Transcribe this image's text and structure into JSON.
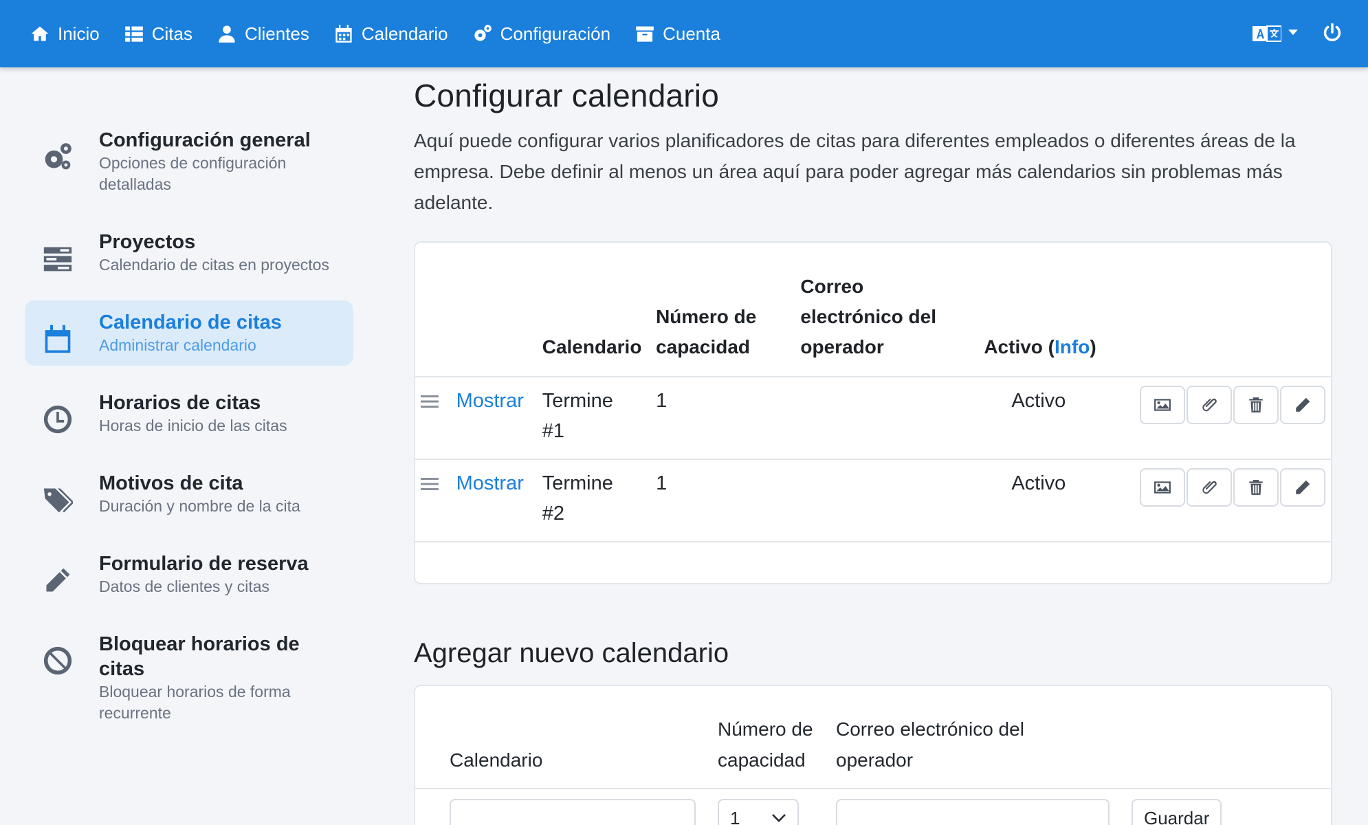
{
  "nav": {
    "items": [
      {
        "label": "Inicio",
        "icon": "home-icon"
      },
      {
        "label": "Citas",
        "icon": "list-icon"
      },
      {
        "label": "Clientes",
        "icon": "user-icon"
      },
      {
        "label": "Calendario",
        "icon": "calendar-icon"
      },
      {
        "label": "Configuración",
        "icon": "gears-icon"
      },
      {
        "label": "Cuenta",
        "icon": "archive-icon"
      }
    ],
    "accent": "#1b7fdc"
  },
  "sidebar": {
    "items": [
      {
        "title": "Configuración general",
        "subtitle": "Opciones de configuración detalladas",
        "icon": "gears-icon"
      },
      {
        "title": "Proyectos",
        "subtitle": "Calendario de citas en proyectos",
        "icon": "server-icon"
      },
      {
        "title": "Calendario de citas",
        "subtitle": "Administrar calendario",
        "icon": "calendar-icon",
        "active": true
      },
      {
        "title": "Horarios de citas",
        "subtitle": "Horas de inicio de las citas",
        "icon": "clock-icon"
      },
      {
        "title": "Motivos de cita",
        "subtitle": "Duración y nombre de la cita",
        "icon": "tags-icon"
      },
      {
        "title": "Formulario de reserva",
        "subtitle": "Datos de clientes y citas",
        "icon": "pencil-icon"
      },
      {
        "title": "Bloquear horarios de citas",
        "subtitle": "Bloquear horarios de forma recurrente",
        "icon": "ban-icon"
      }
    ]
  },
  "main": {
    "title": "Configurar calendario",
    "intro": "Aquí puede configurar varios planificadores de citas para diferentes empleados o diferentes áreas de la empresa. Debe definir al menos un área aquí para poder agregar más calendarios sin problemas más adelante.",
    "table": {
      "headers": {
        "calendar": "Calendario",
        "capacity": "Número de capacidad",
        "email": "Correo electrónico del operador",
        "active_prefix": "Activo (",
        "active_link": "Info",
        "active_suffix": ")"
      },
      "rows": [
        {
          "show": "Mostrar",
          "calendar": "Termine #1",
          "capacity": "1",
          "email": "",
          "active": "Activo"
        },
        {
          "show": "Mostrar",
          "calendar": "Termine #2",
          "capacity": "1",
          "email": "",
          "active": "Activo"
        }
      ]
    },
    "add": {
      "title": "Agregar nuevo calendario",
      "headers": {
        "calendar": "Calendario",
        "capacity": "Número de capacidad",
        "email": "Correo electrónico del operador"
      },
      "capacity_value": "1",
      "save_label": "Guardar"
    }
  }
}
